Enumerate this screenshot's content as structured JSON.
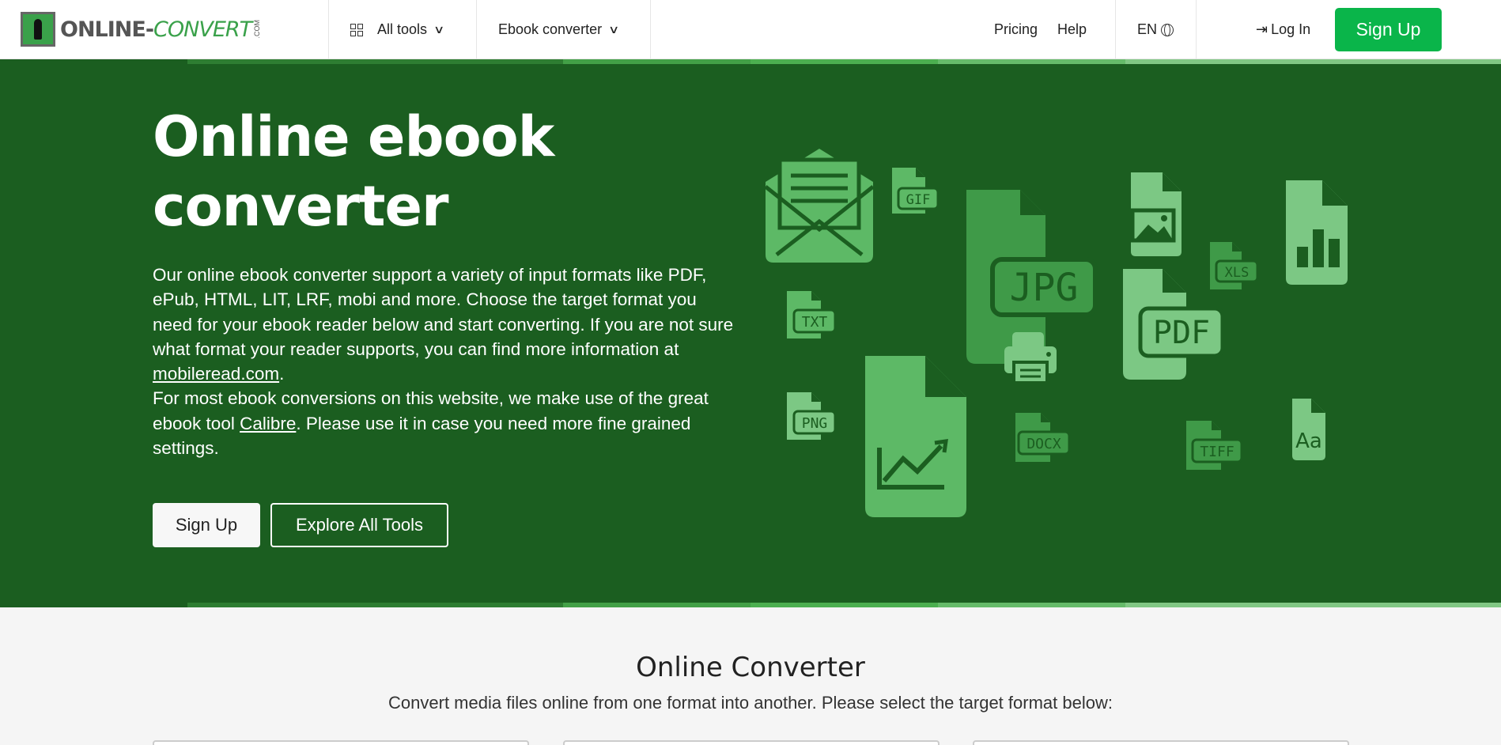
{
  "header": {
    "logo_text_main": "ONLINE-",
    "logo_text_conv": "CONVERT",
    "logo_text_com": ".COM",
    "all_tools_label": "All tools",
    "ebook_converter_label": "Ebook converter",
    "pricing_label": "Pricing",
    "help_label": "Help",
    "language_label": "EN",
    "login_label": "Log In",
    "signup_label": "Sign Up"
  },
  "hero": {
    "title": "Online ebook converter",
    "desc_part1": "Our online ebook converter support a variety of input formats like PDF, ePub, HTML, LIT, LRF, mobi and more. Choose the target format you need for your ebook reader below and start converting. If you are not sure what format your reader supports, you can find more information at ",
    "desc_link1": "mobileread.com",
    "desc_part2": ".",
    "desc_part3": "For most ebook conversions on this website, we make use of the great ebook tool ",
    "desc_link2": "Calibre",
    "desc_part4": ". Please use it in case you need more fine grained settings.",
    "signup_button": "Sign Up",
    "explore_button": "Explore All Tools",
    "file_labels": {
      "gif": "GIF",
      "jpg": "JPG",
      "xls": "XLS",
      "txt": "TXT",
      "pdf": "PDF",
      "png": "PNG",
      "docx": "DOCX",
      "tiff": "TIFF",
      "font": "Aa"
    },
    "colors": {
      "background": "#1b5e20",
      "icon_dark": "#3f9a48",
      "icon_mid": "#5db966",
      "icon_light": "#7cc884"
    }
  },
  "converter_section": {
    "title": "Online Converter",
    "subtitle": "Convert media files online from one format into another. Please select the target format below:"
  }
}
